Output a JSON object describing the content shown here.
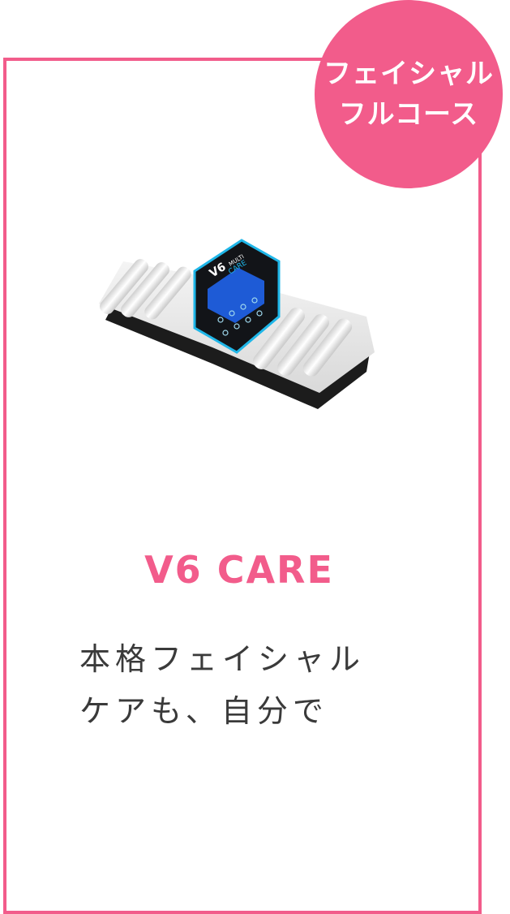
{
  "badge": {
    "line1": "フェイシャル",
    "line2": "フルコース"
  },
  "product": {
    "screen_brand_top": "MULTI",
    "screen_brand_main": "V6",
    "screen_brand_sub": "CARE",
    "accent_color": "#1fb6e8"
  },
  "title": "V6 CARE",
  "description": {
    "line1": "本格フェイシャル",
    "line2": "ケアも、自分で"
  },
  "colors": {
    "brand_pink": "#f25c8b",
    "text_gray": "#3a3a3a"
  }
}
